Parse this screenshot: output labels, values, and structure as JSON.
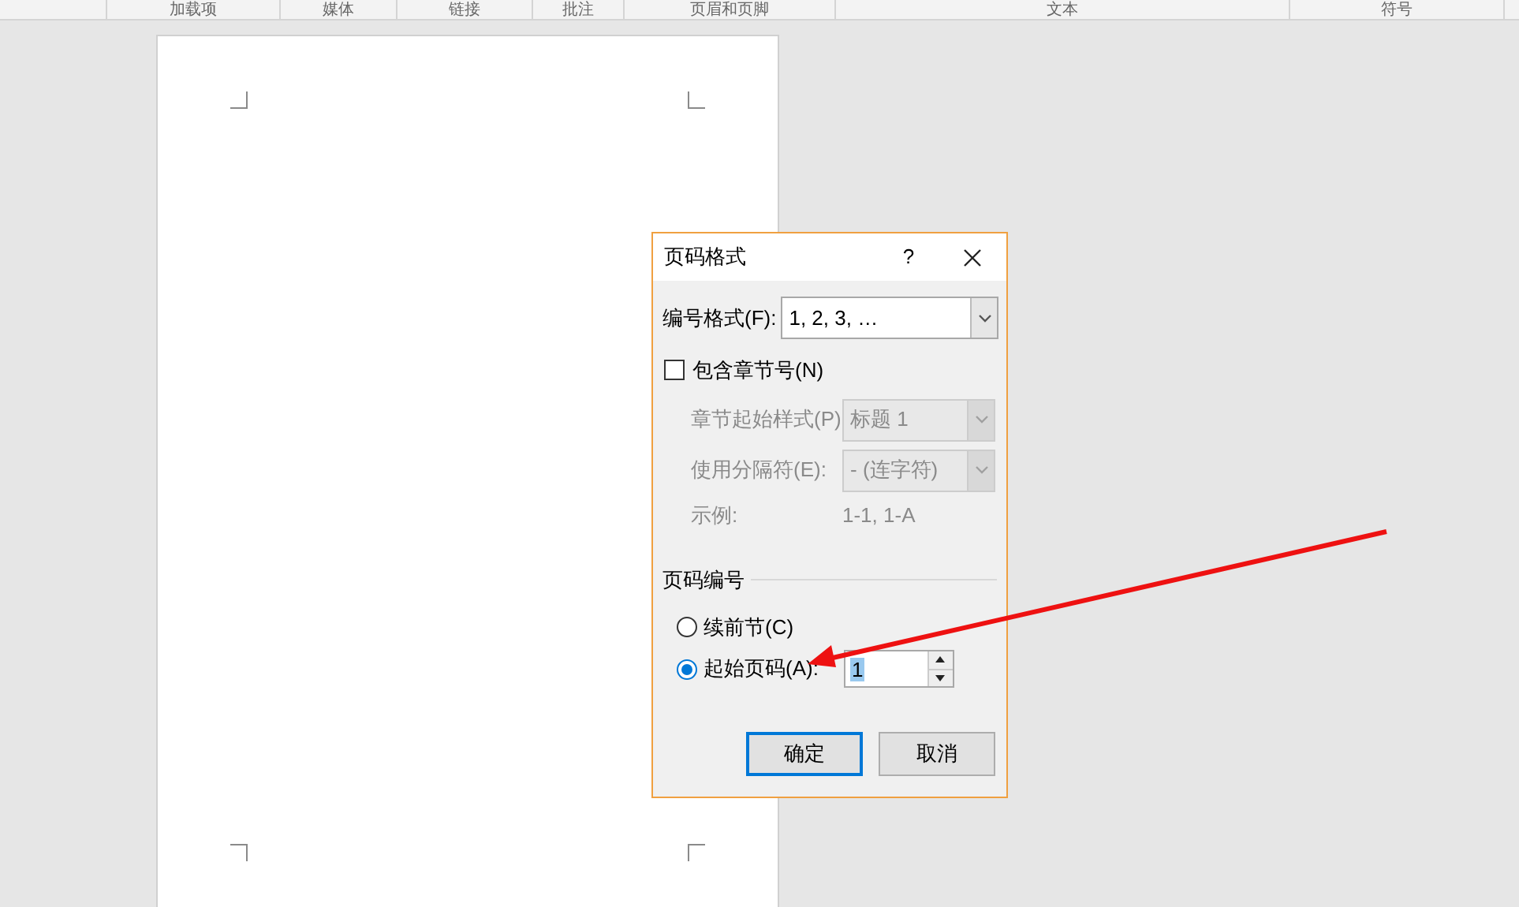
{
  "ribbon_groups": [
    "加载项",
    "媒体",
    "链接",
    "批注",
    "页眉和页脚",
    "文本",
    "符号"
  ],
  "dialog": {
    "title": "页码格式",
    "help": "?",
    "number_format": {
      "label": "编号格式(F):",
      "value": "1, 2, 3, …"
    },
    "include_chapter": {
      "label": "包含章节号(N)",
      "checked": false
    },
    "chapter_style": {
      "label": "章节起始样式(P)",
      "value": "标题 1",
      "disabled": true
    },
    "separator": {
      "label": "使用分隔符(E):",
      "value": "-  (连字符)",
      "disabled": true
    },
    "example": {
      "label": "示例:",
      "value": "1-1, 1-A"
    },
    "section_title": "页码编号",
    "options": [
      {
        "label": "续前节(C)",
        "selected": false
      },
      {
        "label": "起始页码(A):",
        "selected": true,
        "value": "1"
      }
    ],
    "buttons": [
      {
        "label": "确定",
        "default": true
      },
      {
        "label": "取消",
        "default": false
      }
    ]
  }
}
